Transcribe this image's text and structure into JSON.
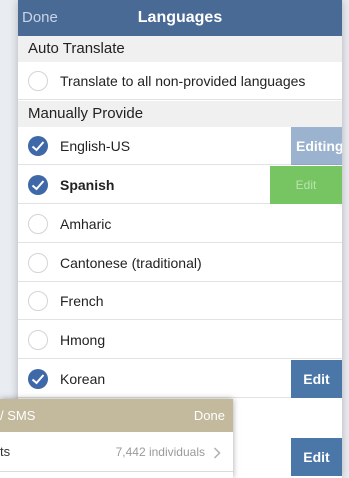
{
  "colors": {
    "nav": "#4a6a96",
    "check": "#3f68a8",
    "edit_blue": "#4a76a8",
    "edit_green": "#76c462",
    "overlay_bar": "#c3b99d"
  },
  "navbar": {
    "done": "Done",
    "title": "Languages"
  },
  "auto_section": {
    "title": "Auto Translate",
    "option_label": "Translate to all non-provided languages",
    "checked": false
  },
  "manual_section": {
    "title": "Manually Provide"
  },
  "languages": [
    {
      "label": "English-US",
      "checked": true,
      "bold": false,
      "button": "Editing"
    },
    {
      "label": "Spanish",
      "checked": true,
      "bold": true,
      "button": "Edit"
    },
    {
      "label": "Amharic",
      "checked": false
    },
    {
      "label": "Cantonese (traditional)",
      "checked": false
    },
    {
      "label": "French",
      "checked": false
    },
    {
      "label": "Hmong",
      "checked": false
    },
    {
      "label": "Korean",
      "checked": true,
      "button": "Edit"
    }
  ],
  "extra_edit": {
    "label": "Edit"
  },
  "overlay": {
    "title": "/ SMS",
    "done": "Done",
    "row_label": "ts",
    "row_count": "7,442 individuals",
    "chevron_icon": "chevron-right-icon"
  }
}
